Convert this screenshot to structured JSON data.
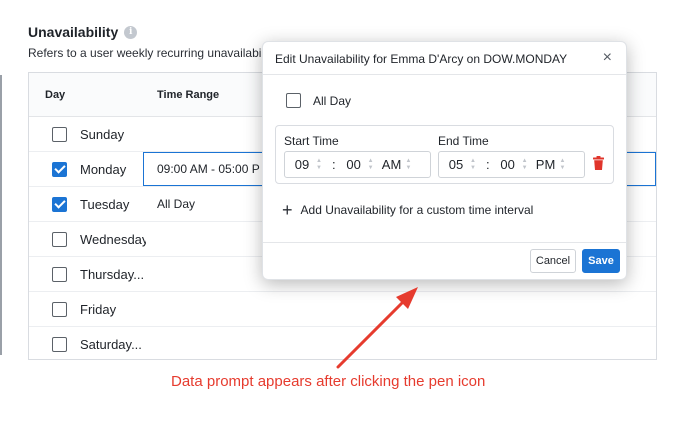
{
  "section": {
    "title": "Unavailability",
    "info_icon": "i",
    "description": "Refers to a user weekly recurring unavailabili"
  },
  "table": {
    "headers": {
      "day": "Day",
      "time_range": "Time Range"
    },
    "rows": [
      {
        "day": "Sunday",
        "checked": false,
        "range": ""
      },
      {
        "day": "Monday",
        "checked": true,
        "range": "09:00 AM - 05:00 P"
      },
      {
        "day": "Tuesday",
        "checked": true,
        "range": "All Day"
      },
      {
        "day": "Wednesday",
        "checked": false,
        "range": ""
      },
      {
        "day": "Thursday...",
        "checked": false,
        "range": ""
      },
      {
        "day": "Friday",
        "checked": false,
        "range": ""
      },
      {
        "day": "Saturday...",
        "checked": false,
        "range": ""
      }
    ]
  },
  "modal": {
    "title": "Edit Unavailability for Emma D'Arcy on DOW.MONDAY",
    "close": "×",
    "all_day_label": "All Day",
    "start_label": "Start Time",
    "end_label": "End Time",
    "start": {
      "hour": "09",
      "minute": "00",
      "period": "AM"
    },
    "end": {
      "hour": "05",
      "minute": "00",
      "period": "PM"
    },
    "colon": ":",
    "add_label": "Add Unavailability for a custom time interval",
    "cancel_label": "Cancel",
    "save_label": "Save"
  },
  "annotation": "Data prompt appears after clicking the pen icon",
  "colors": {
    "accent": "#1b74d4",
    "danger": "#e0352b",
    "annotation": "#e63b2e"
  }
}
